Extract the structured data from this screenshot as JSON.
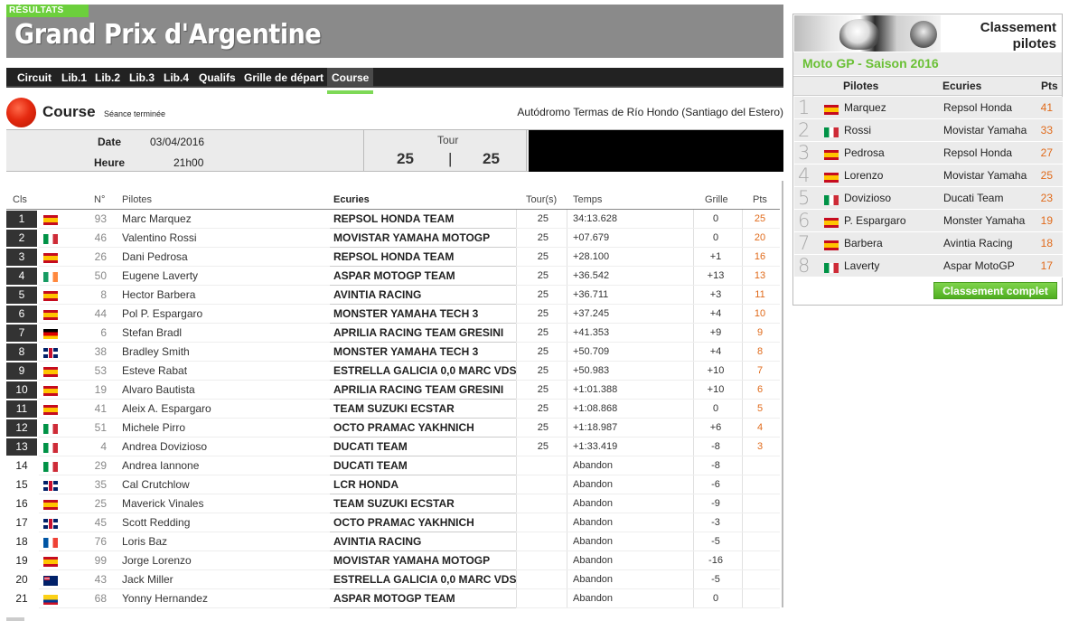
{
  "banner": {
    "tag": "RÉSULTATS",
    "title": "Grand Prix d'Argentine"
  },
  "tabs": [
    "Circuit",
    "Lib.1",
    "Lib.2",
    "Lib.3",
    "Lib.4",
    "Qualifs",
    "Grille de départ",
    "Course"
  ],
  "active_tab": "Course",
  "session": {
    "name": "Course",
    "status": "Séance terminée",
    "circuit": "Autódromo Termas de Río Hondo (Santiago del Estero)",
    "date_label": "Date",
    "date_value": "03/04/2016",
    "hour_label": "Heure",
    "hour_value": "21h00",
    "tour_label": "Tour",
    "tour_current": "25",
    "tour_sep": "|",
    "tour_total": "25"
  },
  "results": {
    "headers": {
      "cls": "Cls",
      "num": "N°",
      "pilot": "Pilotes",
      "team": "Ecuries",
      "tours": "Tour(s)",
      "time": "Temps",
      "grille": "Grille",
      "pts": "Pts"
    },
    "rows": [
      {
        "cls": "1",
        "flag": "es",
        "num": "93",
        "pilot": "Marc Marquez",
        "team": "REPSOL HONDA TEAM",
        "tours": "25",
        "time": "34:13.628",
        "grille": "0",
        "pts": "25"
      },
      {
        "cls": "2",
        "flag": "it",
        "num": "46",
        "pilot": "Valentino Rossi",
        "team": "MOVISTAR YAMAHA MOTOGP",
        "tours": "25",
        "time": "+07.679",
        "grille": "0",
        "pts": "20"
      },
      {
        "cls": "3",
        "flag": "es",
        "num": "26",
        "pilot": "Dani Pedrosa",
        "team": "REPSOL HONDA TEAM",
        "tours": "25",
        "time": "+28.100",
        "grille": "+1",
        "pts": "16"
      },
      {
        "cls": "4",
        "flag": "ie",
        "num": "50",
        "pilot": "Eugene Laverty",
        "team": "ASPAR MOTOGP TEAM",
        "tours": "25",
        "time": "+36.542",
        "grille": "+13",
        "pts": "13"
      },
      {
        "cls": "5",
        "flag": "es",
        "num": "8",
        "pilot": "Hector Barbera",
        "team": "AVINTIA RACING",
        "tours": "25",
        "time": "+36.711",
        "grille": "+3",
        "pts": "11"
      },
      {
        "cls": "6",
        "flag": "es",
        "num": "44",
        "pilot": "Pol P. Espargaro",
        "team": "MONSTER YAMAHA TECH 3",
        "tours": "25",
        "time": "+37.245",
        "grille": "+4",
        "pts": "10"
      },
      {
        "cls": "7",
        "flag": "de",
        "num": "6",
        "pilot": "Stefan Bradl",
        "team": "APRILIA RACING TEAM GRESINI",
        "tours": "25",
        "time": "+41.353",
        "grille": "+9",
        "pts": "9"
      },
      {
        "cls": "8",
        "flag": "gb",
        "num": "38",
        "pilot": "Bradley Smith",
        "team": "MONSTER YAMAHA TECH 3",
        "tours": "25",
        "time": "+50.709",
        "grille": "+4",
        "pts": "8"
      },
      {
        "cls": "9",
        "flag": "es",
        "num": "53",
        "pilot": "Esteve Rabat",
        "team": "ESTRELLA GALICIA 0,0 MARC VDS",
        "tours": "25",
        "time": "+50.983",
        "grille": "+10",
        "pts": "7"
      },
      {
        "cls": "10",
        "flag": "es",
        "num": "19",
        "pilot": "Alvaro Bautista",
        "team": "APRILIA RACING TEAM GRESINI",
        "tours": "25",
        "time": "+1:01.388",
        "grille": "+10",
        "pts": "6"
      },
      {
        "cls": "11",
        "flag": "es",
        "num": "41",
        "pilot": "Aleix A. Espargaro",
        "team": "TEAM SUZUKI ECSTAR",
        "tours": "25",
        "time": "+1:08.868",
        "grille": "0",
        "pts": "5"
      },
      {
        "cls": "12",
        "flag": "it",
        "num": "51",
        "pilot": "Michele Pirro",
        "team": "OCTO PRAMAC YAKHNICH",
        "tours": "25",
        "time": "+1:18.987",
        "grille": "+6",
        "pts": "4"
      },
      {
        "cls": "13",
        "flag": "it",
        "num": "4",
        "pilot": "Andrea Dovizioso",
        "team": "DUCATI TEAM",
        "tours": "25",
        "time": "+1:33.419",
        "grille": "-8",
        "pts": "3"
      },
      {
        "cls": "14",
        "flag": "it",
        "num": "29",
        "pilot": "Andrea Iannone",
        "team": "DUCATI TEAM",
        "tours": "",
        "time": "Abandon",
        "grille": "-8",
        "pts": ""
      },
      {
        "cls": "15",
        "flag": "gb",
        "num": "35",
        "pilot": "Cal Crutchlow",
        "team": "LCR HONDA",
        "tours": "",
        "time": "Abandon",
        "grille": "-6",
        "pts": ""
      },
      {
        "cls": "16",
        "flag": "es",
        "num": "25",
        "pilot": "Maverick Vinales",
        "team": "TEAM SUZUKI ECSTAR",
        "tours": "",
        "time": "Abandon",
        "grille": "-9",
        "pts": ""
      },
      {
        "cls": "17",
        "flag": "gb",
        "num": "45",
        "pilot": "Scott Redding",
        "team": "OCTO PRAMAC YAKHNICH",
        "tours": "",
        "time": "Abandon",
        "grille": "-3",
        "pts": ""
      },
      {
        "cls": "18",
        "flag": "fr",
        "num": "76",
        "pilot": "Loris Baz",
        "team": "AVINTIA RACING",
        "tours": "",
        "time": "Abandon",
        "grille": "-5",
        "pts": ""
      },
      {
        "cls": "19",
        "flag": "es",
        "num": "99",
        "pilot": "Jorge Lorenzo",
        "team": "MOVISTAR YAMAHA MOTOGP",
        "tours": "",
        "time": "Abandon",
        "grille": "-16",
        "pts": ""
      },
      {
        "cls": "20",
        "flag": "au",
        "num": "43",
        "pilot": "Jack Miller",
        "team": "ESTRELLA GALICIA 0,0 MARC VDS",
        "tours": "",
        "time": "Abandon",
        "grille": "-5",
        "pts": ""
      },
      {
        "cls": "21",
        "flag": "co",
        "num": "68",
        "pilot": "Yonny Hernandez",
        "team": "ASPAR MOTOGP TEAM",
        "tours": "",
        "time": "Abandon",
        "grille": "0",
        "pts": ""
      }
    ]
  },
  "standings": {
    "title_line1": "Classement",
    "title_line2": "pilotes",
    "season": "Moto GP - Saison 2016",
    "headers": {
      "pilot": "Pilotes",
      "team": "Ecuries",
      "pts": "Pts"
    },
    "rows": [
      {
        "rank": "1",
        "flag": "es",
        "pilot": "Marquez",
        "team": "Repsol Honda",
        "pts": "41"
      },
      {
        "rank": "2",
        "flag": "it",
        "pilot": "Rossi",
        "team": "Movistar Yamaha",
        "pts": "33"
      },
      {
        "rank": "3",
        "flag": "es",
        "pilot": "Pedrosa",
        "team": "Repsol Honda",
        "pts": "27"
      },
      {
        "rank": "4",
        "flag": "es",
        "pilot": "Lorenzo",
        "team": "Movistar Yamaha",
        "pts": "25"
      },
      {
        "rank": "5",
        "flag": "it",
        "pilot": "Dovizioso",
        "team": "Ducati Team",
        "pts": "23"
      },
      {
        "rank": "6",
        "flag": "es",
        "pilot": "P. Espargaro",
        "team": "Monster Yamaha",
        "pts": "19"
      },
      {
        "rank": "7",
        "flag": "es",
        "pilot": "Barbera",
        "team": "Avintia Racing",
        "pts": "18"
      },
      {
        "rank": "8",
        "flag": "it",
        "pilot": "Laverty",
        "team": "Aspar MotoGP",
        "pts": "17"
      }
    ],
    "button": "Classement complet"
  },
  "colors": {
    "accent_green": "#6ccf3c",
    "points_orange": "#e06a1a",
    "banner_gray": "#8a8a8a"
  }
}
